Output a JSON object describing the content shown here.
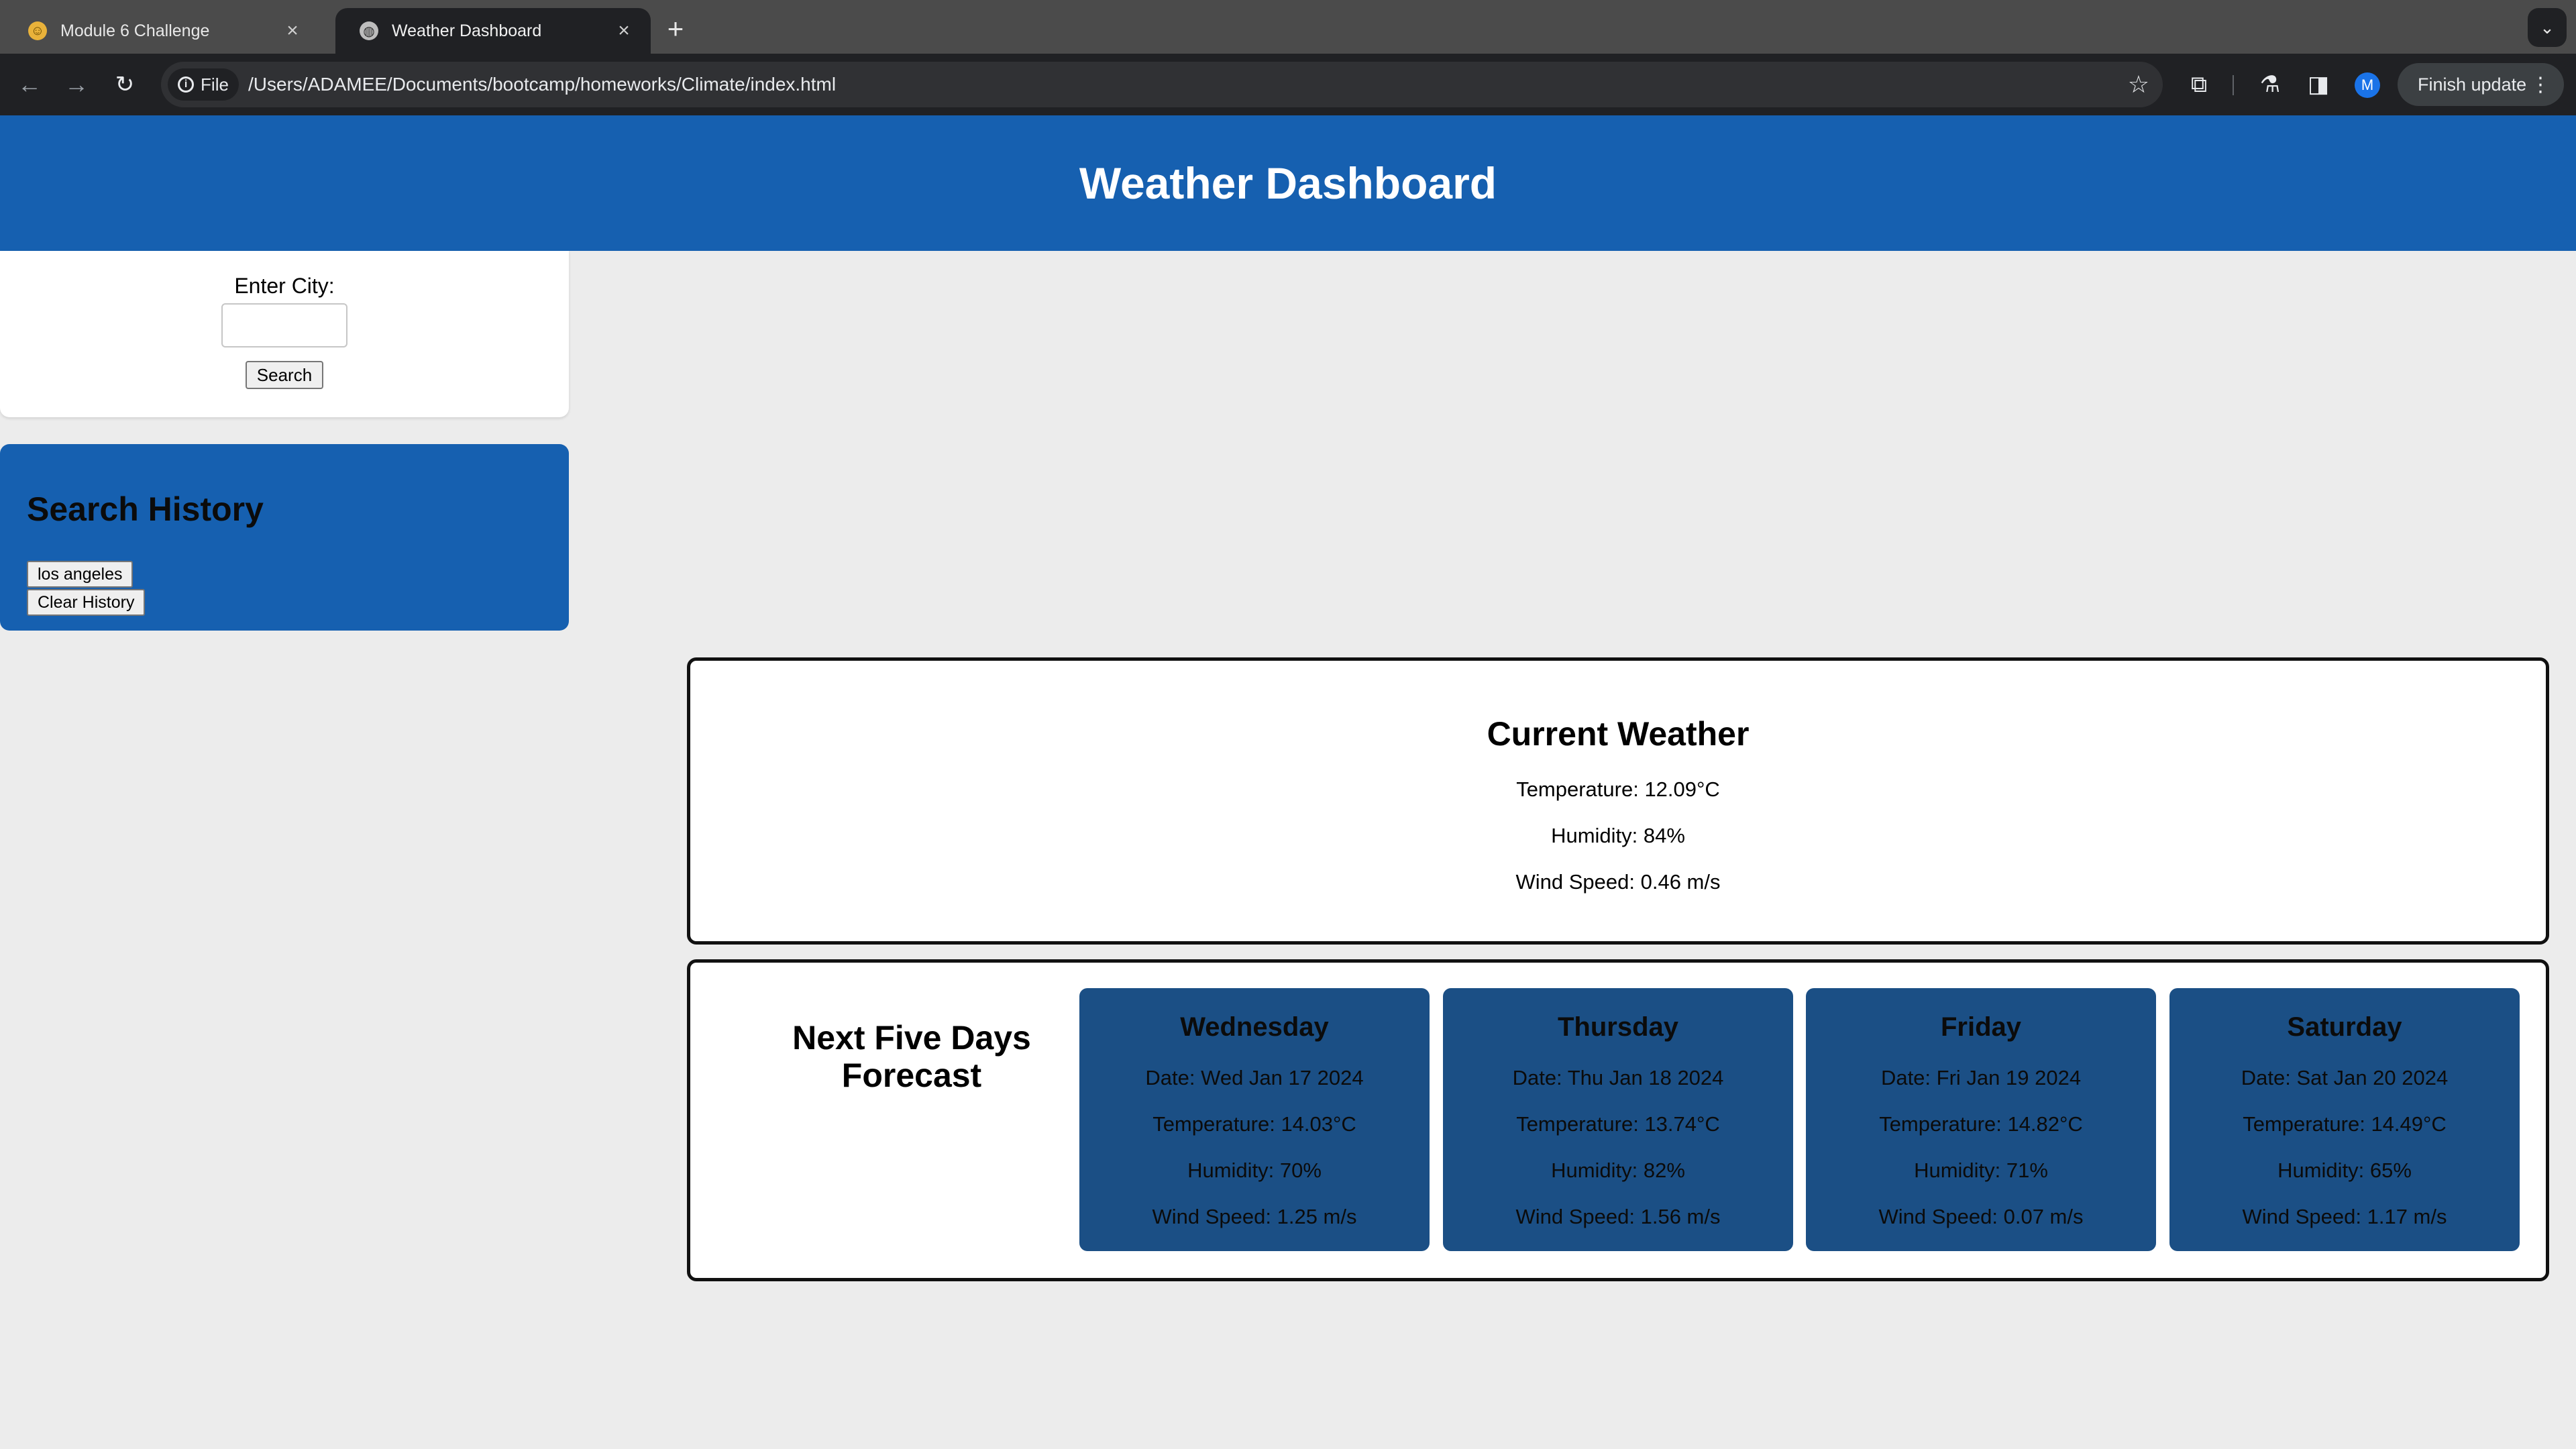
{
  "browser": {
    "tabs": [
      {
        "title": "Module 6 Challenge",
        "active": false
      },
      {
        "title": "Weather Dashboard",
        "active": true
      }
    ],
    "site_chip": "File",
    "url": "/Users/ADAMEE/Documents/bootcamp/homeworks/Climate/index.html",
    "avatar_letter": "M",
    "finish_update": "Finish update"
  },
  "header": {
    "title": "Weather Dashboard"
  },
  "search": {
    "label": "Enter City:",
    "input_value": "",
    "button": "Search"
  },
  "history": {
    "title": "Search History",
    "items": [
      "los angeles"
    ],
    "clear_button": "Clear History"
  },
  "current": {
    "title": "Current Weather",
    "temperature": "Temperature: 12.09°C",
    "humidity": "Humidity: 84%",
    "wind": "Wind Speed: 0.46 m/s"
  },
  "forecast": {
    "title": "Next Five Days Forecast",
    "days": [
      {
        "name": "Wednesday",
        "date": "Date: Wed Jan 17 2024",
        "temperature": "Temperature: 14.03°C",
        "humidity": "Humidity: 70%",
        "wind": "Wind Speed: 1.25 m/s"
      },
      {
        "name": "Thursday",
        "date": "Date: Thu Jan 18 2024",
        "temperature": "Temperature: 13.74°C",
        "humidity": "Humidity: 82%",
        "wind": "Wind Speed: 1.56 m/s"
      },
      {
        "name": "Friday",
        "date": "Date: Fri Jan 19 2024",
        "temperature": "Temperature: 14.82°C",
        "humidity": "Humidity: 71%",
        "wind": "Wind Speed: 0.07 m/s"
      },
      {
        "name": "Saturday",
        "date": "Date: Sat Jan 20 2024",
        "temperature": "Temperature: 14.49°C",
        "humidity": "Humidity: 65%",
        "wind": "Wind Speed: 1.17 m/s"
      }
    ]
  },
  "colors": {
    "header_blue": "#1660b0",
    "card_blue": "#1b4f85",
    "page_bg": "#ececec"
  }
}
